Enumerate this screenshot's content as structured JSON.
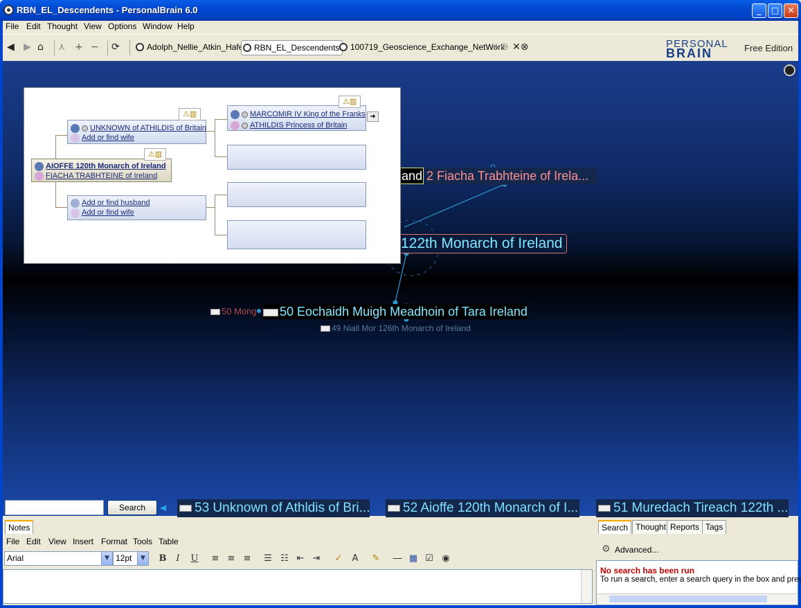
{
  "window": {
    "title": "RBN_EL_Descendents - PersonalBrain 6.0",
    "min": "_",
    "max": "□",
    "close": "✕"
  },
  "menubar": [
    "File",
    "Edit",
    "Thought",
    "View",
    "Options",
    "Window",
    "Help"
  ],
  "toolbar": {
    "brains": [
      {
        "label": "Adolph_Nellie_Atkin_Hafen"
      },
      {
        "label": "RBN_EL_Descendents"
      },
      {
        "label": "100719_Geoscience_Exchange_NetWork"
      }
    ],
    "logo_line1": "PERSONAL",
    "logo_line2": "BRAIN",
    "edition": "Free Edition"
  },
  "plex": {
    "thoughts": {
      "partial_left": "and",
      "fiacha": "2 Fiacha Trabhteine of Irela...",
      "muredach": "122th Monarch of Ireland",
      "mong": "50 Mong",
      "eochaidh": "50 Eochaidh Muigh Meadhoin of Tara Ireland",
      "niall": "49 Niall Mor 126th Monarch of Ireland"
    },
    "colors": {
      "cyan": "#7fe8ff",
      "pink": "#ff9090"
    }
  },
  "family_tree": {
    "focus_father": "AIOFFE 120th Monarch of Ireland",
    "focus_mother": "FIACHA TRABHTEINE of Ireland",
    "parent_top_father": "UNKNOWN of ATHILDIS of Britain",
    "parent_top_mother": "Add or find wife",
    "gp_father": "MARCOMIR IV King of the Franks",
    "gp_mother": "ATHILDIS Princess of Britain",
    "parent_bottom_father": "Add or find husband",
    "parent_bottom_mother": "Add or find wife"
  },
  "search_bar": {
    "button": "Search",
    "crumbs": [
      "53 Unknown of Athldis of Bri...",
      "52 Aioffe 120th Monarch of I...",
      "51 Muredach Tireach 122th ..."
    ]
  },
  "notes": {
    "tab": "Notes",
    "menu": [
      "File",
      "Edit",
      "View",
      "Insert",
      "Format",
      "Tools",
      "Table"
    ],
    "font": "Arial",
    "size": "12pt"
  },
  "side_panel": {
    "tabs": [
      "Search",
      "Thought",
      "Reports",
      "Tags"
    ],
    "advanced": "Advanced...",
    "msg_title": "No search has been run",
    "msg_body": "To run a search, enter a search query in the box and press"
  }
}
